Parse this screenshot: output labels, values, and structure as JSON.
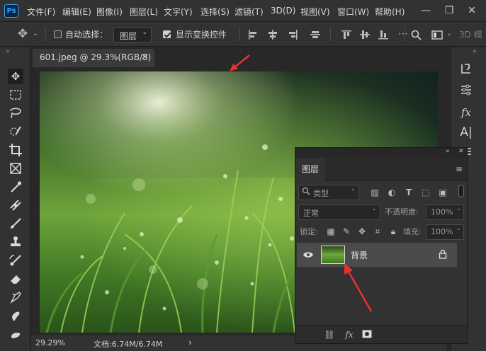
{
  "app": {
    "logo": "Ps",
    "accent": "#31a8ff",
    "bg": "#282828"
  },
  "menu": [
    "文件(F)",
    "编辑(E)",
    "图像(I)",
    "图层(L)",
    "文字(Y)",
    "选择(S)",
    "滤镜(T)",
    "3D(D)",
    "视图(V)",
    "窗口(W)",
    "帮助(H)"
  ],
  "window_controls": {
    "minimize": "—",
    "restore": "❐",
    "close": "✕"
  },
  "options": {
    "auto_select_label": "自动选择：",
    "auto_select_checked": false,
    "target_value": "图层",
    "show_transform_label": "显示变换控件",
    "show_transform_checked": true,
    "mode_3d": "3D 模"
  },
  "document": {
    "tab_title": "601.jpeg @ 29.3%(RGB/8)",
    "close": "×"
  },
  "status": {
    "zoom": "29.29%",
    "doc_info": "文档:6.74M/6.74M",
    "more": "›"
  },
  "layers_panel": {
    "tab": "图层",
    "filter_label": "类型",
    "blend_mode": "正常",
    "opacity_label": "不透明度:",
    "opacity_value": "100%",
    "lock_label": "锁定:",
    "fill_label": "填充:",
    "fill_value": "100%",
    "layers": [
      {
        "name": "背景",
        "visible": true,
        "locked": true
      }
    ]
  },
  "annotations": {
    "arrow_color": "#e8312a"
  },
  "icons": [
    "ps-logo",
    "move-icon",
    "marquee-icon",
    "lasso-icon",
    "quick-select-icon",
    "crop-icon",
    "frame-icon",
    "eyedropper-icon",
    "healing-icon",
    "brush-icon",
    "stamp-icon",
    "history-brush-icon",
    "eraser-icon",
    "gradient-icon",
    "blur-icon",
    "smudge-icon",
    "eye-icon",
    "lock-icon",
    "link-icon",
    "fx-icon",
    "mask-icon",
    "search-icon"
  ]
}
